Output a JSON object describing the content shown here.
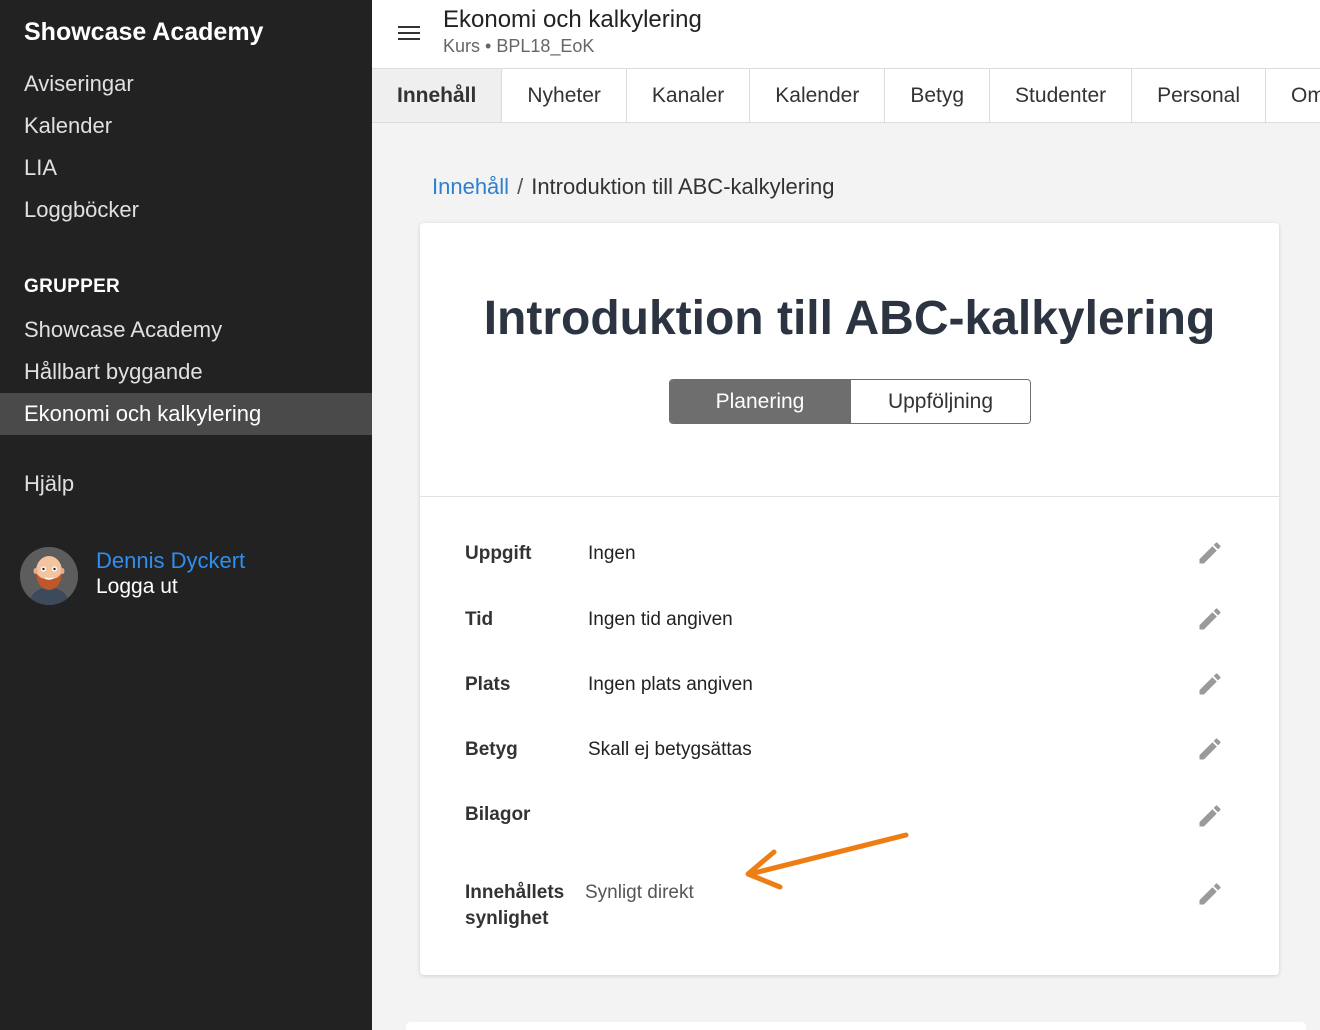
{
  "sidebar": {
    "brand": "Showcase Academy",
    "nav": [
      {
        "label": "Aviseringar"
      },
      {
        "label": "Kalender"
      },
      {
        "label": "LIA"
      },
      {
        "label": "Loggböcker"
      }
    ],
    "groups_heading": "GRUPPER",
    "groups": [
      {
        "label": "Showcase Academy"
      },
      {
        "label": "Hållbart byggande"
      },
      {
        "label": "Ekonomi och kalkylering",
        "active": true
      }
    ],
    "help": "Hjälp",
    "user": {
      "name": "Dennis Dyckert",
      "logout": "Logga ut"
    }
  },
  "header": {
    "title": "Ekonomi och kalkylering",
    "subtitle": "Kurs • BPL18_EoK"
  },
  "tabs": [
    {
      "label": "Innehåll",
      "active": true
    },
    {
      "label": "Nyheter"
    },
    {
      "label": "Kanaler"
    },
    {
      "label": "Kalender"
    },
    {
      "label": "Betyg"
    },
    {
      "label": "Studenter"
    },
    {
      "label": "Personal"
    },
    {
      "label": "Om"
    }
  ],
  "breadcrumb": {
    "link": "Innehåll",
    "separator": "/",
    "current": "Introduktion till ABC-kalkylering"
  },
  "content": {
    "title": "Introduktion till ABC-kalkylering",
    "toggle": {
      "active": "Planering",
      "inactive": "Uppföljning"
    },
    "rows": [
      {
        "label": "Uppgift",
        "value": "Ingen"
      },
      {
        "label": "Tid",
        "value": "Ingen tid angiven"
      },
      {
        "label": "Plats",
        "value": "Ingen plats angiven"
      },
      {
        "label": "Betyg",
        "value": "Skall ej betygsättas"
      },
      {
        "label": "Bilagor",
        "value": ""
      },
      {
        "label": "Innehållets synlighet",
        "value": "Synligt direkt"
      }
    ]
  },
  "colors": {
    "sidebar_bg": "#222222",
    "active_nav_bg": "#4a4a4a",
    "link_blue": "#2f8ff0",
    "annotation_orange": "#ee7d14",
    "toggle_active_bg": "#6e6e6e"
  },
  "icons": {
    "menu": "hamburger-icon",
    "edit": "pencil-icon",
    "annotation": "arrow-icon"
  }
}
